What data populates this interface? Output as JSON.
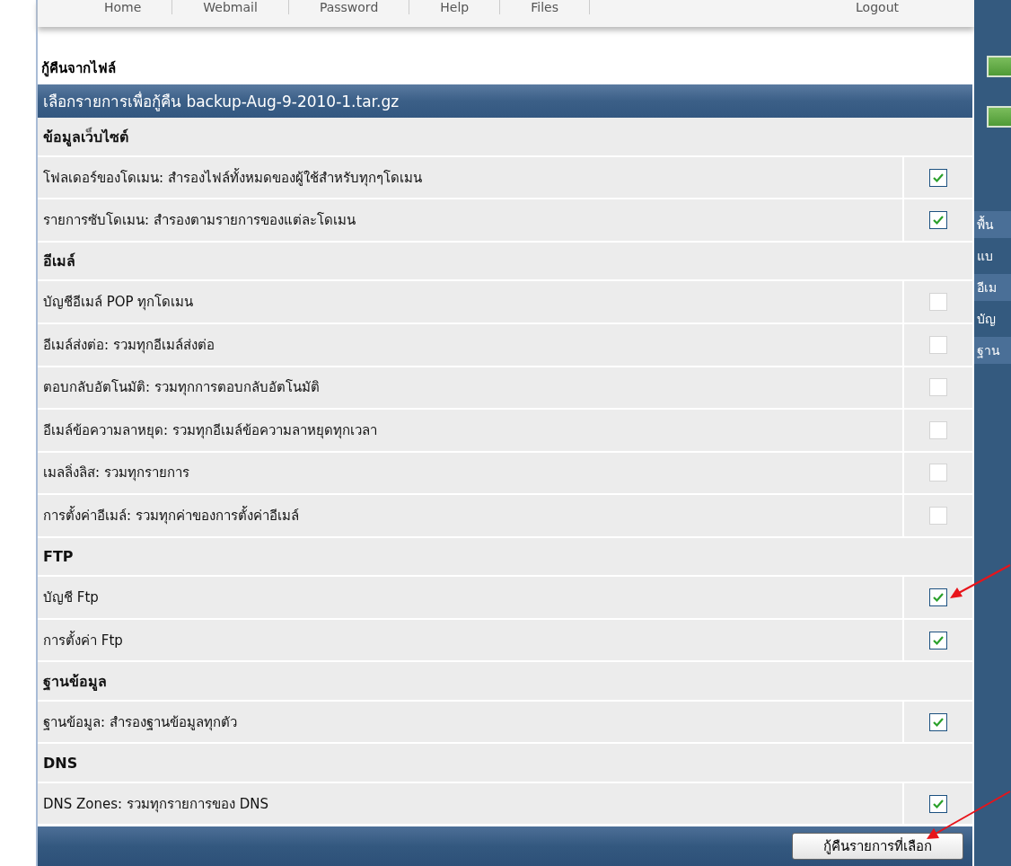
{
  "nav": [
    {
      "label": "Home"
    },
    {
      "label": "Webmail"
    },
    {
      "label": "Password"
    },
    {
      "label": "Help"
    },
    {
      "label": "Files"
    },
    {
      "label": "Logout"
    }
  ],
  "title": "กู้คืนจากไฟล์",
  "header": "เลือกรายการเพื่อกู้คืน backup-Aug-9-2010-1.tar.gz",
  "rows": [
    {
      "kind": "section",
      "label": "ข้อมูลเว็บไซต์"
    },
    {
      "kind": "item",
      "label": "โฟลเดอร์ของโดเมน: สำรองไฟล์ทั้งหมดของผู้ใช้สำหรับทุกๆโดเมน",
      "checked": true
    },
    {
      "kind": "item",
      "label": "รายการซับโดเมน: สำรองตามรายการของแต่ละโดเมน",
      "checked": true
    },
    {
      "kind": "section",
      "label": "อีเมล์"
    },
    {
      "kind": "item",
      "label": "บัญชีอีเมล์ POP ทุกโดเมน",
      "checked": false
    },
    {
      "kind": "item",
      "label": "อีเมล์ส่งต่อ: รวมทุกอีเมล์ส่งต่อ",
      "checked": false
    },
    {
      "kind": "item",
      "label": "ตอบกลับอัตโนมัติ: รวมทุกการตอบกลับอัตโนมัติ",
      "checked": false
    },
    {
      "kind": "item",
      "label": "อีเมล์ข้อความลาหยุด: รวมทุกอีเมล์ข้อความลาหยุดทุกเวลา",
      "checked": false
    },
    {
      "kind": "item",
      "label": "เมลลิ่งลิส: รวมทุกรายการ",
      "checked": false
    },
    {
      "kind": "item",
      "label": "การตั้งค่าอีเมล์: รวมทุกค่าของการตั้งค่าอีเมล์",
      "checked": false
    },
    {
      "kind": "section",
      "label": "FTP"
    },
    {
      "kind": "item",
      "label": "บัญชี Ftp",
      "checked": true
    },
    {
      "kind": "item",
      "label": "การตั้งค่า Ftp",
      "checked": true
    },
    {
      "kind": "section",
      "label": "ฐานข้อมูล"
    },
    {
      "kind": "item",
      "label": "ฐานข้อมูล: สำรองฐานข้อมูลทุกตัว",
      "checked": true
    },
    {
      "kind": "section",
      "label": "DNS"
    },
    {
      "kind": "item",
      "label": "DNS Zones: รวมทุกรายการของ DNS",
      "checked": true
    }
  ],
  "submit": "กู้คืนรายการที่เลือก",
  "sidebar": {
    "items": [
      {
        "label": "พื้น",
        "selected": true
      },
      {
        "label": "แบ",
        "selected": false
      },
      {
        "label": "อีเม",
        "selected": true
      },
      {
        "label": "บัญ",
        "selected": false
      },
      {
        "label": "ฐาน",
        "selected": true
      }
    ]
  }
}
